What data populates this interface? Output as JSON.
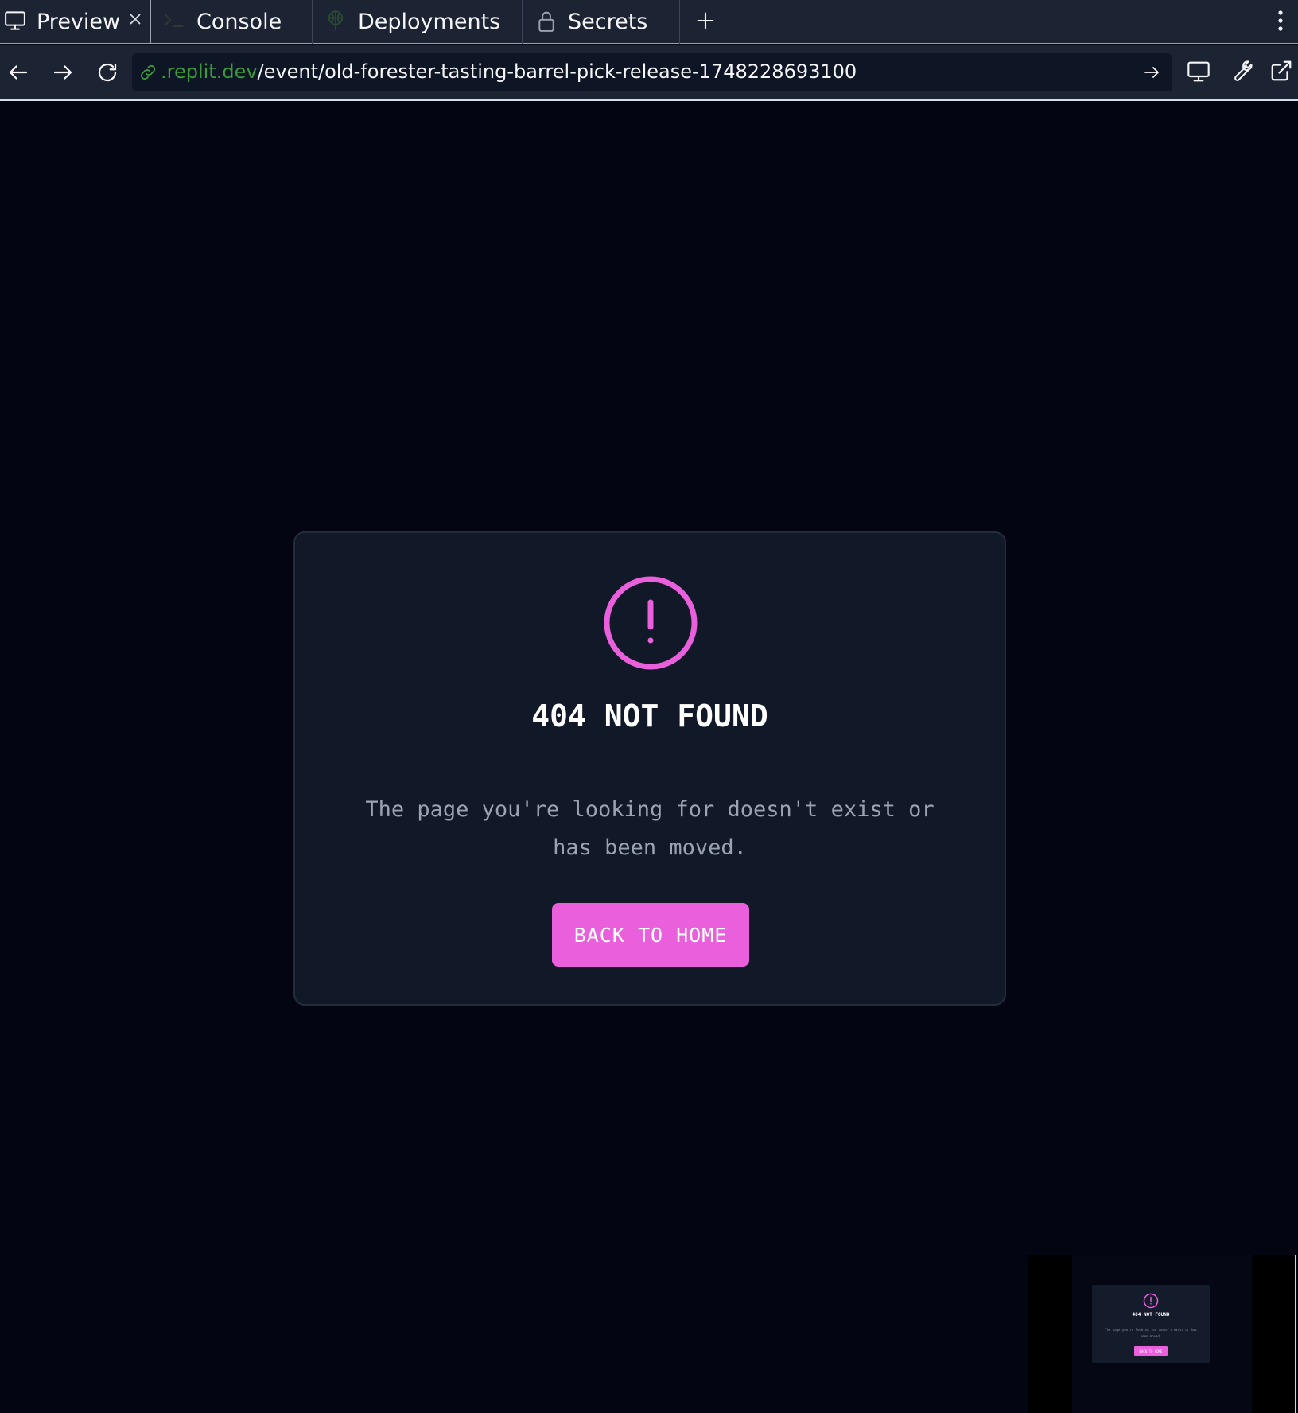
{
  "tabs": {
    "preview": {
      "label": "Preview",
      "icon": "monitor-icon",
      "active": true
    },
    "console": {
      "label": "Console",
      "icon": "terminal-icon"
    },
    "deployments": {
      "label": "Deployments",
      "icon": "deployments-icon"
    },
    "secrets": {
      "label": "Secrets",
      "icon": "lock-icon"
    },
    "close_icon": "close-icon",
    "add_icon": "plus-icon",
    "more_icon": "more-vertical-icon"
  },
  "browser": {
    "url_domain": ".replit.dev",
    "url_path": "/event/old-forester-tasting-barrel-pick-release-1748228693100",
    "icons": [
      "back-arrow-icon",
      "forward-arrow-icon",
      "reload-icon",
      "link-icon",
      "go-arrow-icon",
      "device-icon",
      "wrench-icon",
      "external-link-icon"
    ]
  },
  "page": {
    "title": "404 NOT FOUND",
    "message": "The page you're looking for doesn't exist or has been moved.",
    "button_label": "BACK TO HOME",
    "icon": "alert-circle-icon"
  },
  "minimap": {
    "title": "404 NOT FOUND",
    "message": "The page you're looking for doesn't exist or has been moved.",
    "button_label": "BACK TO HOME"
  },
  "colors": {
    "accent": "#e95fdc",
    "chrome_bg": "#1c2333",
    "page_bg": "#030612",
    "card_bg": "#111827",
    "url_domain": "#3c9a3a",
    "muted_text": "#9aa3b1"
  }
}
